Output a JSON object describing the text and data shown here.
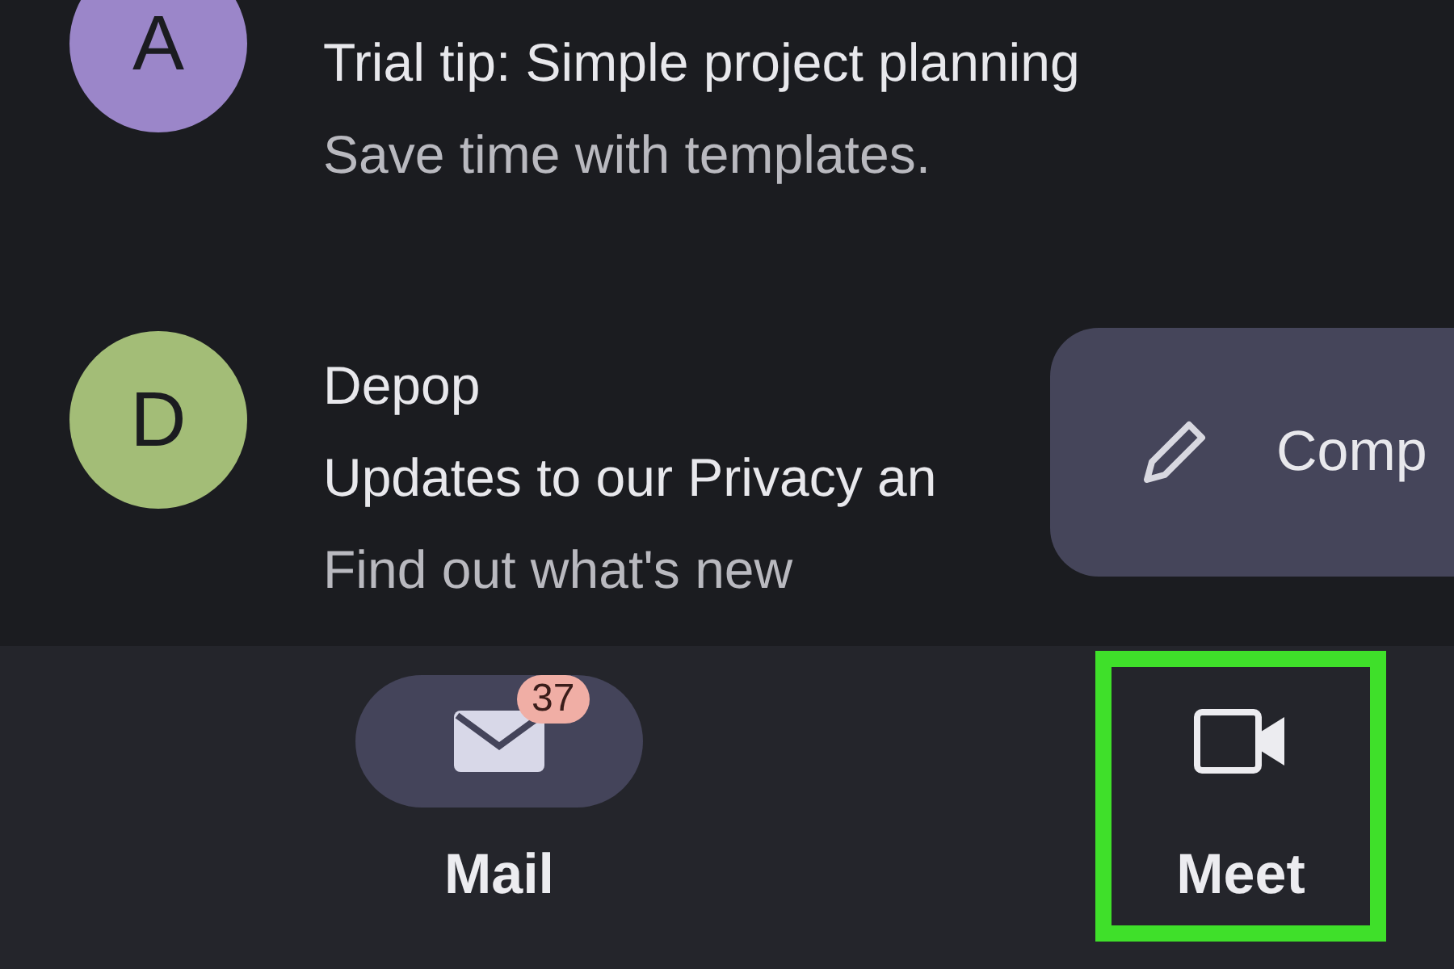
{
  "messages": [
    {
      "avatar": "A",
      "color": "#9b86c9",
      "lines": [
        {
          "text": "Trial tip: Simple project planning",
          "kind": "subject"
        },
        {
          "text": "Save time with templates.",
          "kind": "snippet"
        }
      ]
    },
    {
      "avatar": "D",
      "color": "#a3bd77",
      "lines": [
        {
          "text": "Depop",
          "kind": "sender"
        },
        {
          "text": "Updates to our Privacy an",
          "kind": "subject"
        },
        {
          "text": "Find out what's new",
          "kind": "snippet"
        }
      ]
    }
  ],
  "compose": {
    "label": "Comp"
  },
  "nav": [
    {
      "label": "Mail",
      "kind": "mail",
      "badge": "37",
      "selected": true,
      "highlighted": false
    },
    {
      "label": "Meet",
      "kind": "video",
      "selected": false,
      "highlighted": true
    }
  ]
}
